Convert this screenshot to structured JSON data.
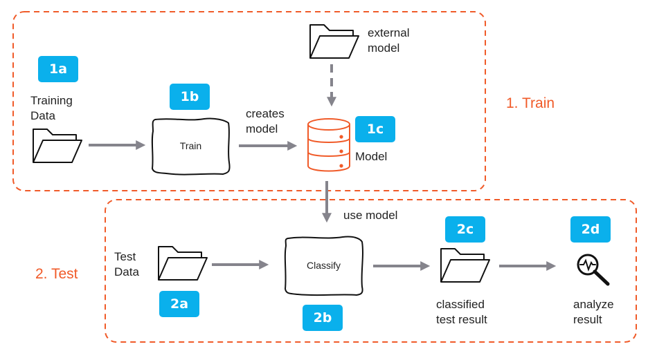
{
  "sections": {
    "train": {
      "label": "1. Train"
    },
    "test": {
      "label": "2. Test"
    }
  },
  "colors": {
    "accent": "#f05a28",
    "badge": "#0ab0ec",
    "arrow": "#85848c",
    "outline": "#111111"
  },
  "nodes": {
    "training_data": {
      "badge": "1a",
      "label_line1": "Training",
      "label_line2": "Data",
      "icon": "folder-icon"
    },
    "train": {
      "badge": "1b",
      "label": "Train"
    },
    "model": {
      "badge": "1c",
      "label": "Model",
      "icon": "database-icon"
    },
    "external_model": {
      "label_line1": "external",
      "label_line2": "model",
      "icon": "folder-icon"
    },
    "test_data": {
      "badge": "2a",
      "label_line1": "Test",
      "label_line2": "Data",
      "icon": "folder-icon"
    },
    "classify": {
      "badge": "2b",
      "label": "Classify"
    },
    "classified_result": {
      "badge": "2c",
      "label_line1": "classified",
      "label_line2": "test result",
      "icon": "folder-icon"
    },
    "analyze_result": {
      "badge": "2d",
      "label_line1": "analyze",
      "label_line2": "result",
      "icon": "magnifier-waveform-icon"
    }
  },
  "edges": {
    "creates_model": {
      "line1": "creates",
      "line2": "model"
    },
    "use_model": {
      "label": "use model"
    }
  }
}
